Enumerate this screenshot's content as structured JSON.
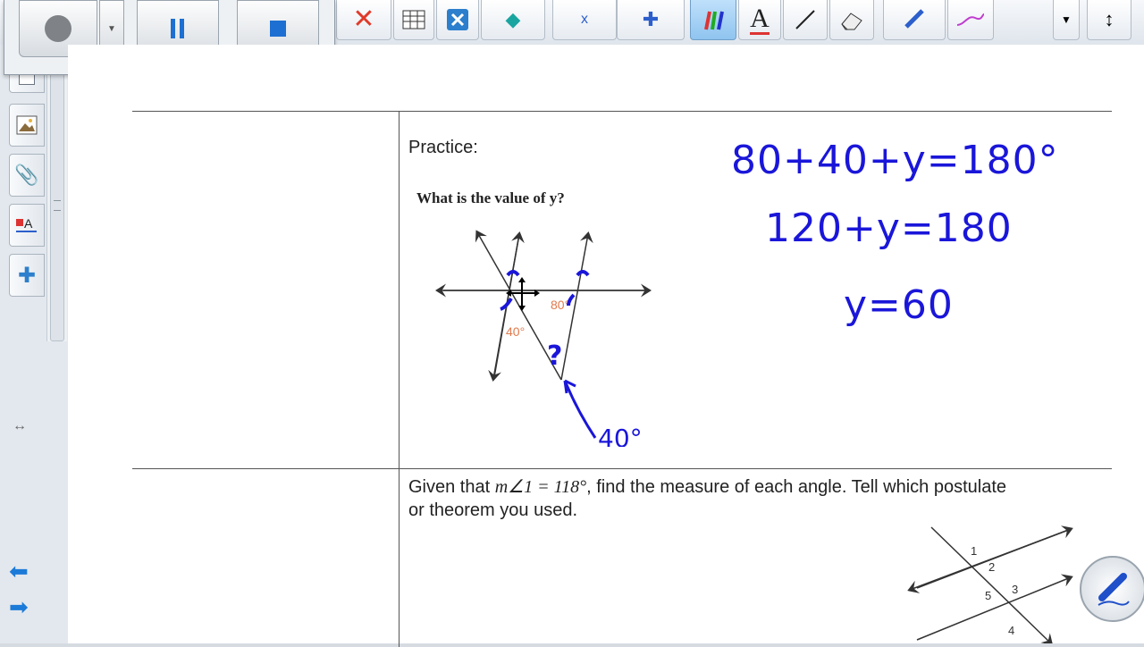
{
  "toolbar": {
    "buttons": [
      "delete",
      "table",
      "properties",
      "fill",
      "shapes-x",
      "gallery",
      "pens",
      "text",
      "line",
      "eraser",
      "creative-pen",
      "magic-pen",
      "more",
      "move-toolbar"
    ]
  },
  "recorder": {
    "record": "record",
    "dropdown": "options",
    "pause": "pause",
    "stop": "stop"
  },
  "practice": {
    "heading": "Practice:",
    "question": "What is the value of y?",
    "angle_80": "80°",
    "angle_40": "40°",
    "annot_question": "?",
    "annot_40": "40°"
  },
  "work": {
    "line1": "80+40+y=180°",
    "line2": "120+y=180",
    "line3": "y=60"
  },
  "problem2": {
    "prefix": "Given that ",
    "math": "m∠1 = 118°",
    "suffix": ", find the measure of each angle.  Tell which postulate",
    "line2": "or theorem you used.",
    "labels": [
      "1",
      "2",
      "3",
      "4",
      "5"
    ]
  },
  "colors": {
    "ink_blue": "#1a16d9",
    "angle_orange": "#e07a4d",
    "nav_blue": "#1c7ad8"
  }
}
